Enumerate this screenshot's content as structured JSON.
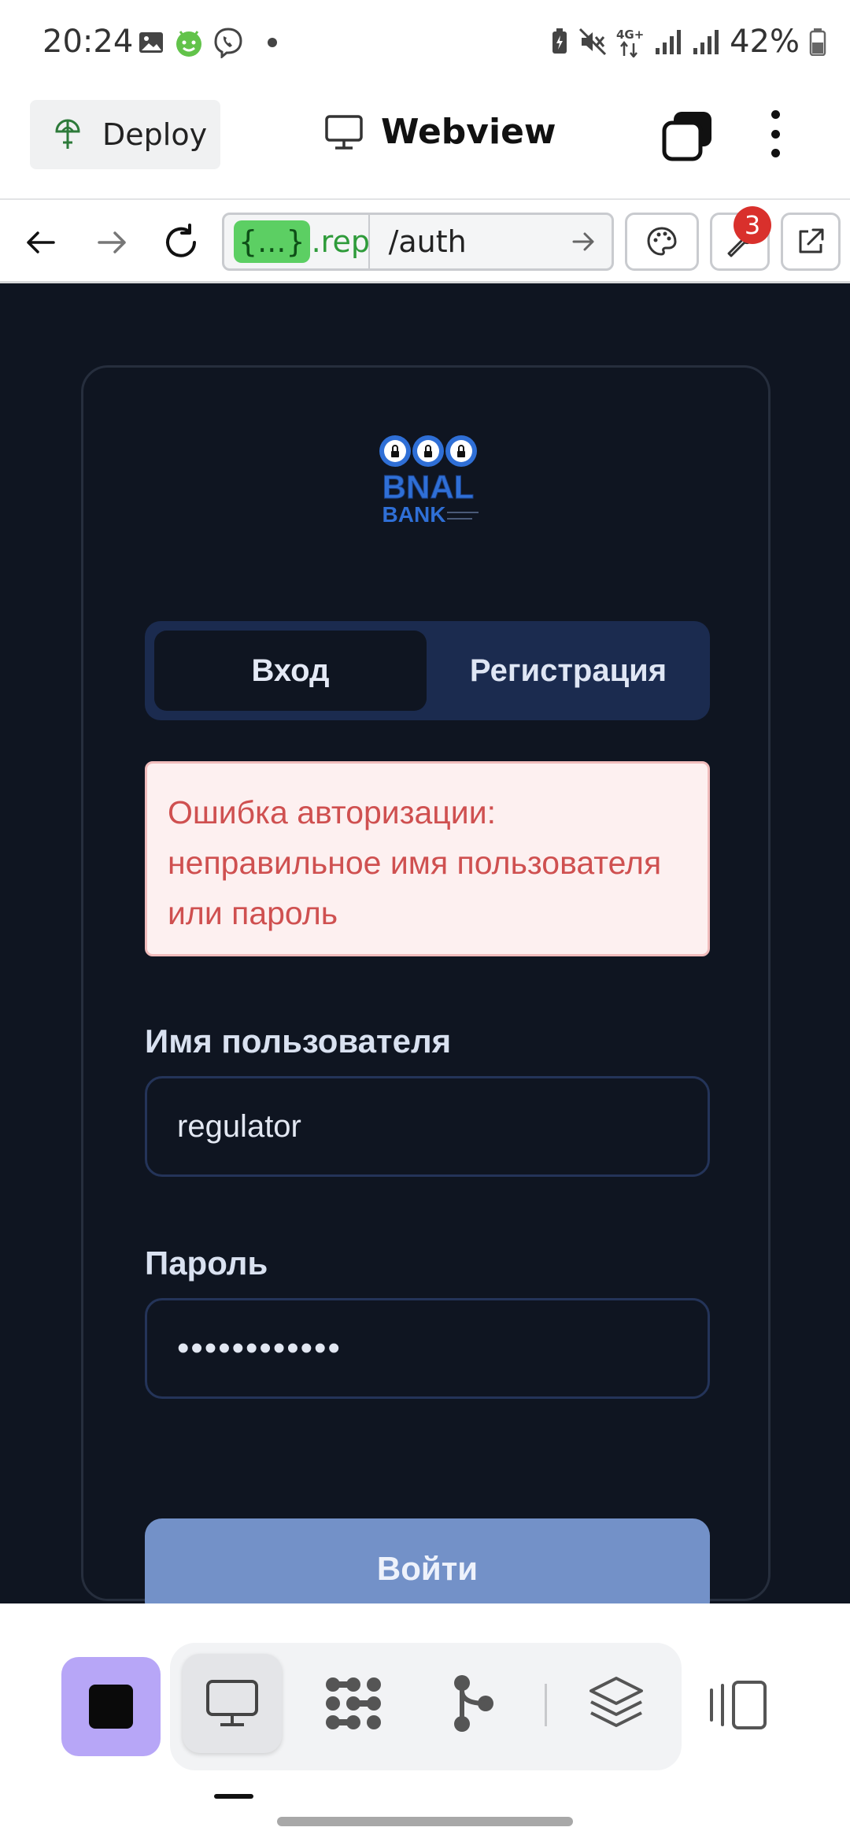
{
  "status_bar": {
    "time": "20:24",
    "network": "4G+",
    "battery": "42%",
    "icons": [
      "image-icon",
      "android-icon",
      "viber-icon",
      "notification-dot",
      "battery-saver-icon",
      "mute-icon",
      "signal-icon",
      "battery-icon"
    ]
  },
  "app_bar": {
    "deploy_label": "Deploy",
    "title": "Webview"
  },
  "browser": {
    "url_chip": "{...}",
    "url_domain": ".repl",
    "url_path": "/auth",
    "badge_count": "3"
  },
  "login": {
    "logo_top": "BNAL",
    "logo_bottom": "BANK",
    "tab_login": "Вход",
    "tab_register": "Регистрация",
    "error_message": "Ошибка авторизации: неправильное имя пользователя или пароль",
    "username_label": "Имя пользователя",
    "username_value": "regulator",
    "password_label": "Пароль",
    "password_value": "••••••••••••",
    "submit_label": "Войти"
  },
  "colors": {
    "page_background": "#0f1521",
    "tab_bg": "#1b2b4f",
    "error_text": "#cf5050",
    "error_bg": "#fdf0f0",
    "submit_bg": "#7391c8",
    "stop_button": "#b7a6f7",
    "url_chip": "#5ccf63"
  }
}
